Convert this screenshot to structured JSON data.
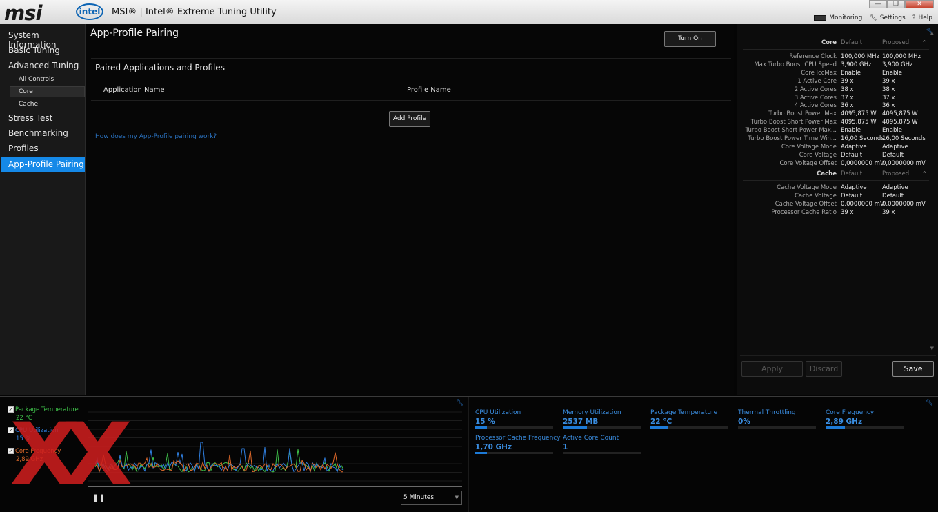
{
  "window": {
    "brand": "msi",
    "intel_logo": "intel",
    "title": "MSI® | Intel® Extreme Tuning Utility",
    "controls": [
      "—",
      "❐",
      "✕"
    ],
    "links": [
      {
        "label": "Monitoring",
        "icon": "monitor-icon"
      },
      {
        "label": "Settings",
        "icon": "wrench-icon"
      },
      {
        "label": "Help",
        "icon": "help-icon"
      }
    ]
  },
  "sidebar": {
    "system_information": "System Information",
    "basic_tuning": "Basic Tuning",
    "advanced_tuning": "Advanced Tuning",
    "all_controls": "All Controls",
    "core": "Core",
    "cache": "Cache",
    "stress_test": "Stress Test",
    "benchmarking": "Benchmarking",
    "profiles": "Profiles",
    "app_profile_pairing": "App-Profile Pairing"
  },
  "main": {
    "title": "App-Profile Pairing",
    "turn_on": "Turn On",
    "section": "Paired Applications and Profiles",
    "col_application": "Application Name",
    "col_profile": "Profile Name",
    "add_profile": "Add Profile",
    "help_link": "How does my App-Profile pairing work?"
  },
  "right_panel": {
    "core_head": {
      "label": "Core",
      "default": "Default",
      "proposed": "Proposed"
    },
    "core_rows": [
      {
        "label": "Reference Clock",
        "default": "100,000 MHz",
        "proposed": "100,000 MHz"
      },
      {
        "label": "Max Turbo Boost CPU Speed",
        "default": "3,900 GHz",
        "proposed": "3,900 GHz"
      },
      {
        "label": "Core IccMax",
        "default": "Enable",
        "proposed": "Enable"
      },
      {
        "label": "1 Active Core",
        "default": "39 x",
        "proposed": "39 x"
      },
      {
        "label": "2 Active Cores",
        "default": "38 x",
        "proposed": "38 x"
      },
      {
        "label": "3 Active Cores",
        "default": "37 x",
        "proposed": "37 x"
      },
      {
        "label": "4 Active Cores",
        "default": "36 x",
        "proposed": "36 x"
      },
      {
        "label": "Turbo Boost Power Max",
        "default": "4095,875 W",
        "proposed": "4095,875 W"
      },
      {
        "label": "Turbo Boost Short Power Max",
        "default": "4095,875 W",
        "proposed": "4095,875 W"
      },
      {
        "label": "Turbo Boost Short Power Max...",
        "default": "Enable",
        "proposed": "Enable"
      },
      {
        "label": "Turbo Boost Power Time Win...",
        "default": "16,00 Seconds",
        "proposed": "16,00 Seconds"
      },
      {
        "label": "Core Voltage Mode",
        "default": "Adaptive",
        "proposed": "Adaptive"
      },
      {
        "label": "Core Voltage",
        "default": "Default",
        "proposed": "Default"
      },
      {
        "label": "Core Voltage Offset",
        "default": "0,0000000 mV",
        "proposed": "0,0000000 mV"
      }
    ],
    "cache_head": {
      "label": "Cache",
      "default": "Default",
      "proposed": "Proposed"
    },
    "cache_rows": [
      {
        "label": "Cache Voltage Mode",
        "default": "Adaptive",
        "proposed": "Adaptive"
      },
      {
        "label": "Cache Voltage",
        "default": "Default",
        "proposed": "Default"
      },
      {
        "label": "Cache Voltage Offset",
        "default": "0,0000000 mV",
        "proposed": "0,0000000 mV"
      },
      {
        "label": "Processor Cache Ratio",
        "default": "39 x",
        "proposed": "39 x"
      }
    ],
    "apply": "Apply",
    "discard": "Discard",
    "save": "Save"
  },
  "monitor": {
    "legend": [
      {
        "label": "Package Temperature",
        "value": "22 °C",
        "color": "#3fc24a",
        "checked": true
      },
      {
        "label": "CPU Utilization",
        "value": "15 %",
        "color": "#2f7fe0",
        "checked": true
      },
      {
        "label": "Core Frequency",
        "value": "2,89 GHz",
        "color": "#e0692a",
        "checked": true
      }
    ],
    "timespan": "5 Minutes",
    "watermark": "XX",
    "metrics": [
      {
        "label": "CPU Utilization",
        "value": "15 %",
        "fill": 0.15
      },
      {
        "label": "Memory Utilization",
        "value": "2537  MB",
        "fill": 0.31
      },
      {
        "label": "Package Temperature",
        "value": "22 °C",
        "fill": 0.22
      },
      {
        "label": "Thermal Throttling",
        "value": "0%",
        "fill": 0
      },
      {
        "label": "Core Frequency",
        "value": "2,89 GHz",
        "fill": 0.25
      },
      {
        "label": "Processor Cache Frequency",
        "value": "1,70 GHz",
        "fill": 0.15
      },
      {
        "label": "Active Core Count",
        "value": "1",
        "fill": 0
      }
    ]
  }
}
